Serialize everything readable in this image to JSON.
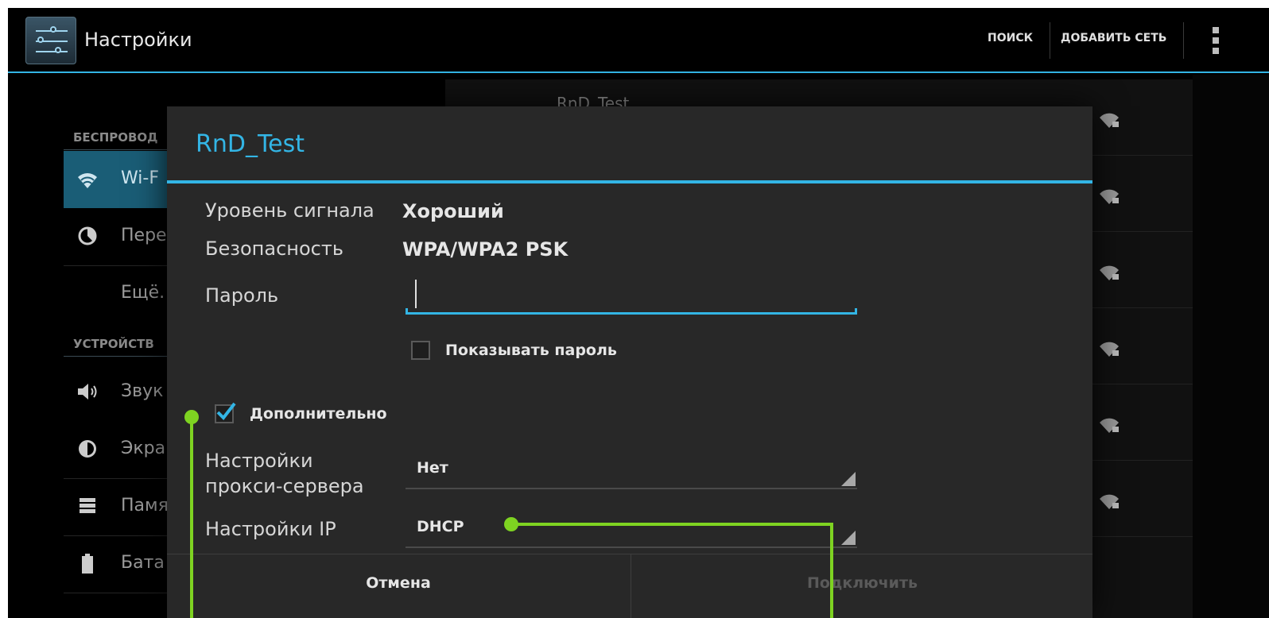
{
  "colors": {
    "accent": "#33b5e5",
    "selection": "#1a5d76",
    "callout": "#7ed321"
  },
  "action_bar": {
    "title": "Настройки",
    "search_label": "ПОИСК",
    "add_network_label": "ДОБАВИТЬ СЕТЬ",
    "overflow_icon": "overflow-menu-icon"
  },
  "sidebar": {
    "header_wireless": "БЕСПРОВОД",
    "header_device": "УСТРОЙСТВ",
    "items": [
      {
        "label": "Wi-F",
        "icon": "wifi-icon"
      },
      {
        "label": "Пере",
        "icon": "data-usage-icon"
      },
      {
        "label": "Ещё.",
        "icon": ""
      },
      {
        "label": "Звук",
        "icon": "sound-icon"
      },
      {
        "label": "Экра",
        "icon": "display-icon"
      },
      {
        "label": "Памя",
        "icon": "storage-icon"
      },
      {
        "label": "Бата",
        "icon": "battery-icon"
      }
    ]
  },
  "networks": {
    "peek_name": "RnD_Test",
    "secured_icon": "wifi-lock-icon"
  },
  "dialog": {
    "title": "RnD_Test",
    "signal_label": "Уровень сигнала",
    "signal_value": "Хороший",
    "security_label": "Безопасность",
    "security_value": "WPA/WPA2 PSK",
    "password_label": "Пароль",
    "password_value": "",
    "show_password_label": "Показывать пароль",
    "show_password_checked": false,
    "advanced_label": "Дополнительно",
    "advanced_checked": true,
    "proxy_label": "Настройки прокси-сервера",
    "proxy_value": "Нет",
    "ip_label": "Настройки IP",
    "ip_value": "DHCP",
    "cancel_label": "Отмена",
    "connect_label": "Подключить"
  }
}
